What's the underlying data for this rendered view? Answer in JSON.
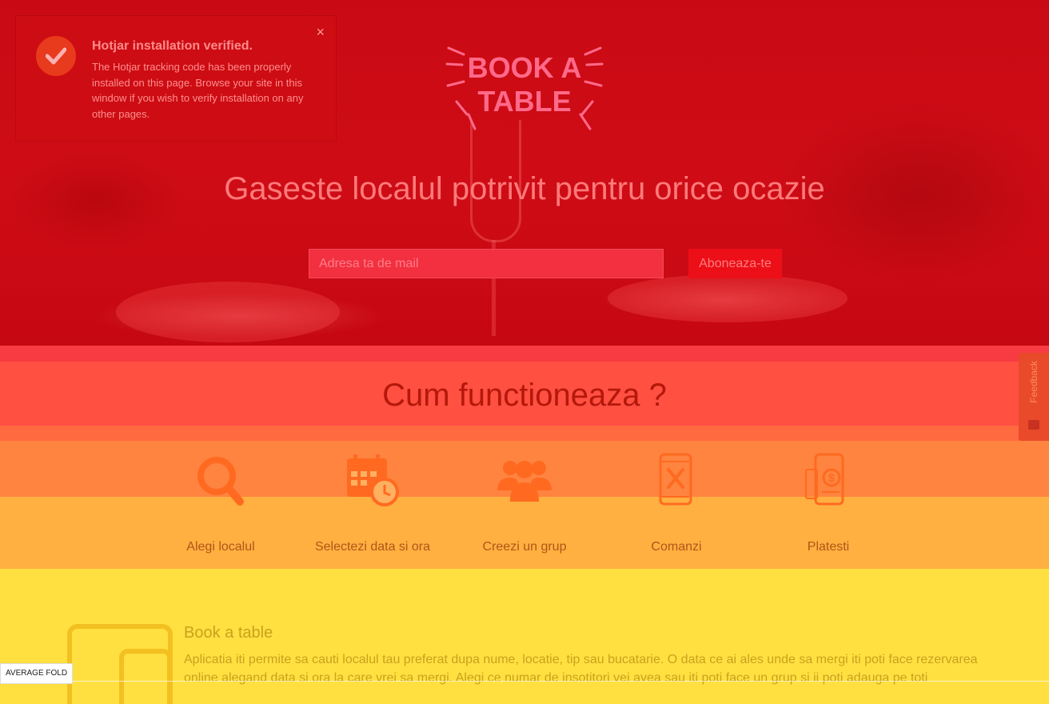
{
  "toast": {
    "title": "Hotjar installation verified.",
    "body": "The Hotjar tracking code has been properly installed on this page. Browse your site in this window if you wish to verify installation on any other pages.",
    "close": "×"
  },
  "logo": {
    "line1": "BOOK A",
    "line2": "TABLE"
  },
  "hero": {
    "headline": "Gaseste localul potrivit pentru orice ocazie",
    "email_placeholder": "Adresa ta de mail",
    "subscribe_label": "Aboneaza-te"
  },
  "how": {
    "title": "Cum functioneaza ?",
    "steps": [
      {
        "label": "Alegi localul",
        "icon": "search-icon"
      },
      {
        "label": "Selectezi data si ora",
        "icon": "calendar-clock-icon"
      },
      {
        "label": "Creezi un grup",
        "icon": "group-icon"
      },
      {
        "label": "Comanzi",
        "icon": "phone-menu-icon"
      },
      {
        "label": "Platesti",
        "icon": "phone-payment-icon"
      }
    ]
  },
  "feedback": {
    "label": "Feedback"
  },
  "book": {
    "title": "Book a table",
    "text": "Aplicatia iti permite sa cauti localul tau preferat dupa nume, locatie, tip sau bucatarie. O data ce ai ales unde sa mergi iti poti face rezervarea online alegand data si ora la care vrei sa mergi. Alegi ce numar de insotitori vei avea sau iti poti face un grup si ii poti adauga pe toti"
  },
  "fold": {
    "label": "AVERAGE FOLD"
  },
  "colors": {
    "hero_red": "#cf0c16",
    "heat_red": "#ff5042",
    "heat_orange": "#ff8440",
    "heat_amber": "#ffb040",
    "heat_yellow": "#ffe040"
  }
}
